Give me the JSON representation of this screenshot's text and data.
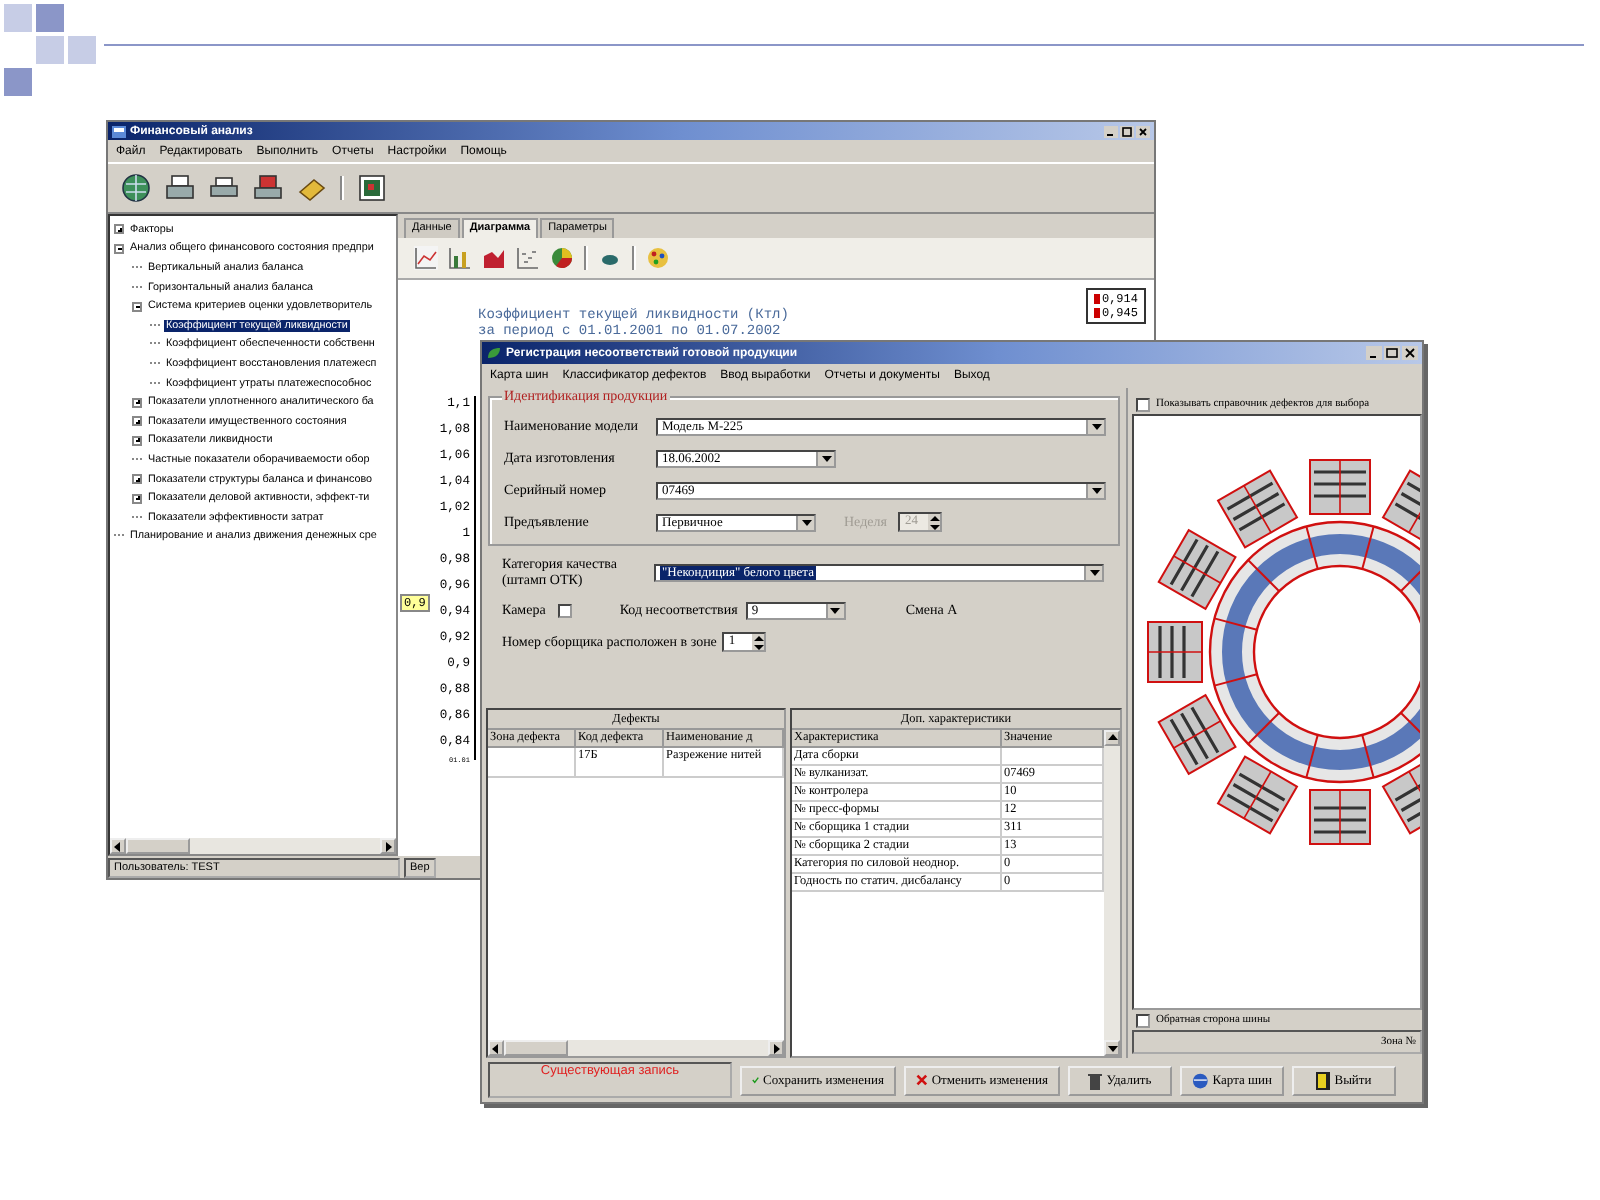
{
  "back_window": {
    "title": "Финансовый анализ",
    "menu": [
      "Файл",
      "Редактировать",
      "Выполнить",
      "Отчеты",
      "Настройки",
      "Помощь"
    ],
    "tree": [
      {
        "label": "Факторы",
        "expanded": false,
        "selected": false
      },
      {
        "label": "Анализ общего финансового состояния предпри",
        "expanded": true,
        "selected": false,
        "children": [
          {
            "label": "Вертикальный анализ баланса",
            "selected": false
          },
          {
            "label": "Горизонтальный анализ баланса",
            "selected": false
          },
          {
            "label": "Система критериев оценки удовлетворитель",
            "expanded": true,
            "selected": false,
            "children": [
              {
                "label": "Коэффициент текущей ликвидности",
                "selected": true
              },
              {
                "label": "Коэффициент обеспеченности собственн",
                "selected": false
              },
              {
                "label": "Коэффициент восстановления платежесп",
                "selected": false
              },
              {
                "label": "Коэффициент утраты платежеспособнос",
                "selected": false
              }
            ]
          },
          {
            "label": "Показатели уплотненного аналитического ба",
            "expanded": false,
            "selected": false
          },
          {
            "label": "Показатели имущественного состояния",
            "expanded": false,
            "selected": false
          },
          {
            "label": "Показатели ликвидности",
            "expanded": false,
            "selected": false
          },
          {
            "label": "Частные показатели оборачиваемости обор",
            "selected": false
          },
          {
            "label": "Показатели структуры баланса и финансово",
            "expanded": false,
            "selected": false
          },
          {
            "label": "Показатели деловой активности, эффект-ти",
            "expanded": false,
            "selected": false
          },
          {
            "label": "Показатели эффективности затрат",
            "selected": false
          }
        ]
      },
      {
        "label": "Планирование и анализ движения денежных сре",
        "selected": false
      }
    ],
    "tabs": [
      {
        "label": "Данные",
        "selected": false
      },
      {
        "label": "Диаграмма",
        "selected": true
      },
      {
        "label": "Параметры",
        "selected": false
      }
    ],
    "chart": {
      "title": "Коэффициент текущей ликвидности (Ктл)",
      "subtitle": "за период с 01.01.2001 по 01.07.2002",
      "y_axis_labels": [
        "1,1",
        "1,08",
        "1,06",
        "1,04",
        "1,02",
        "1",
        "0,98",
        "0,96",
        "0,94",
        "0,92",
        "0,9",
        "0,88",
        "0,86",
        "0,84"
      ],
      "x_axis_label": "01.01",
      "value_label": "0,9",
      "legend": [
        "0,914",
        "0,945"
      ]
    },
    "status_bar": {
      "user": "Пользователь: TEST",
      "version": "Вер"
    }
  },
  "front_window": {
    "title": "Регистрация несоответствий готовой продукции",
    "menu": [
      "Карта шин",
      "Классификатор дефектов",
      "Ввод выработки",
      "Отчеты и документы",
      "Выход"
    ],
    "group_title": "Идентификация продукции",
    "fields": [
      {
        "label": "Наименование модели",
        "value": "Модель М-225"
      },
      {
        "label": "Дата изготовления",
        "value": "18.06.2002"
      },
      {
        "label": "Серийный номер",
        "value": "07469"
      },
      {
        "label": "Предъявление",
        "value": "Первичное"
      }
    ],
    "week": {
      "label": "Неделя",
      "value": "24",
      "disabled": true
    },
    "quality": {
      "label": "Категория качества (штамп ОТК)",
      "value": "\"Некондиция\" белого цвета"
    },
    "camera": {
      "label": "Камера",
      "checked": false
    },
    "defect_code": {
      "label": "Код несоответствия",
      "value": "9"
    },
    "shift": "Смена  А",
    "assembler_zone": {
      "label": "Номер сборщика расположен в зоне",
      "value": "1"
    },
    "defects_table": {
      "title": "Дефекты",
      "columns": [
        "Зона дефекта",
        "Код дефекта",
        "Наименование д"
      ],
      "rows": [
        {
          "code": "17Б",
          "name": "Разрежение нитей"
        }
      ]
    },
    "extra_table": {
      "title": "Доп. характеристики",
      "columns": [
        "Характеристика",
        "Значение"
      ],
      "rows": [
        {
          "name": "Дата сборки"
        },
        {
          "name": "№ вулканизат.",
          "value": "07469"
        },
        {
          "name": "№ контролера",
          "value": "10"
        },
        {
          "name": "№ пресс-формы",
          "value": "12"
        },
        {
          "name": "№ сборщика 1 стадии",
          "value": "311"
        },
        {
          "name": "№ сборщика 2 стадии",
          "value": "13"
        },
        {
          "name": "Категория по силовой неоднор.",
          "value": "0"
        },
        {
          "name": "Годность по статич. дисбалансу",
          "value": "0"
        }
      ]
    },
    "status": "Существующая запись",
    "buttons": [
      {
        "label": "Сохранить изменения",
        "kind": "save"
      },
      {
        "label": "Отменить изменения",
        "kind": "cancel"
      },
      {
        "label": "Удалить",
        "kind": "delete"
      },
      {
        "label": "Карта шин",
        "kind": "map"
      },
      {
        "label": "Выйти",
        "kind": "exit"
      }
    ],
    "show_defects": {
      "label": "Показывать справочник дефектов для выбора",
      "checked": false
    },
    "reverse_side": {
      "label": "Обратная сторона шины",
      "checked": false
    },
    "zone": "Зона №"
  }
}
